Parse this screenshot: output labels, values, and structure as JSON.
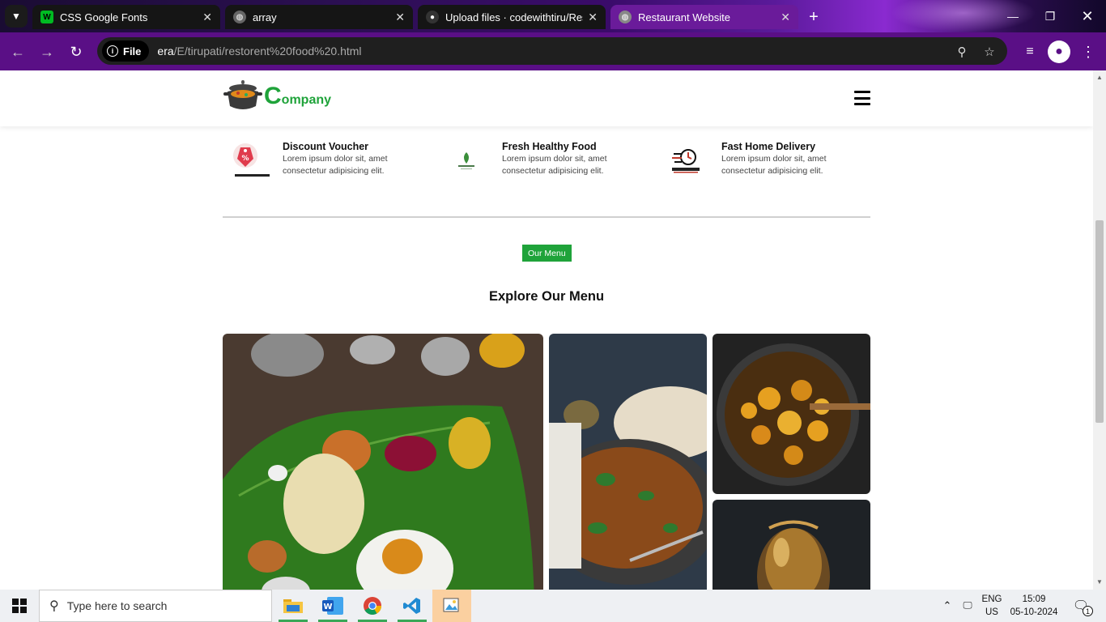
{
  "browser": {
    "tabs": [
      {
        "title": "CSS Google Fonts",
        "favicon": "w-icon"
      },
      {
        "title": "array",
        "favicon": "globe-icon"
      },
      {
        "title": "Upload files · codewithtiru/Resto",
        "favicon": "github-icon"
      },
      {
        "title": "Restaurant Website",
        "favicon": "globe-icon"
      }
    ],
    "address": {
      "chip_label": "File",
      "url_host": "era",
      "url_path": "/E/tirupati/restorent%20food%20.html"
    }
  },
  "site": {
    "logo": {
      "initial": "C",
      "rest": "ompany"
    },
    "features": [
      {
        "title": "Discount Voucher",
        "desc": "Lorem ipsum dolor sit, amet consectetur adipisicing elit."
      },
      {
        "title": "Fresh Healthy Food",
        "desc": "Lorem ipsum dolor sit, amet consectetur adipisicing elit."
      },
      {
        "title": "Fast Home Delivery",
        "desc": "Lorem ipsum dolor sit, amet consectetur adipisicing elit."
      }
    ],
    "menu_badge": "Our Menu",
    "menu_title": "Explore Our Menu"
  },
  "taskbar": {
    "search_placeholder": "Type here to search",
    "lang_top": "ENG",
    "lang_bottom": "US",
    "time": "15:09",
    "date": "05-10-2024",
    "notification_count": "1"
  },
  "colors": {
    "brand_green": "#1fa33a",
    "browser_purple": "#5a0f86",
    "active_tab": "#6a1b9a"
  }
}
